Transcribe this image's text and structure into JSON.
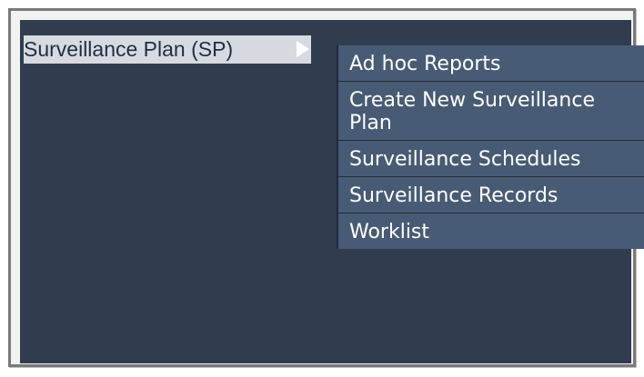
{
  "menu": {
    "parent_label": "Surveillance Plan (SP)",
    "items": [
      {
        "label": "Ad hoc Reports"
      },
      {
        "label": "Create New Surveillance Plan"
      },
      {
        "label": "Surveillance Schedules"
      },
      {
        "label": "Surveillance Records"
      },
      {
        "label": "Worklist"
      }
    ]
  },
  "colors": {
    "panel_background": "#313d4f",
    "submenu_background": "#485b74",
    "parent_highlight": "#d7dbe1",
    "text_light": "#ffffff",
    "text_dark": "#1f2e47"
  },
  "icons": {
    "submenu_indicator": "arrow-right-icon"
  }
}
